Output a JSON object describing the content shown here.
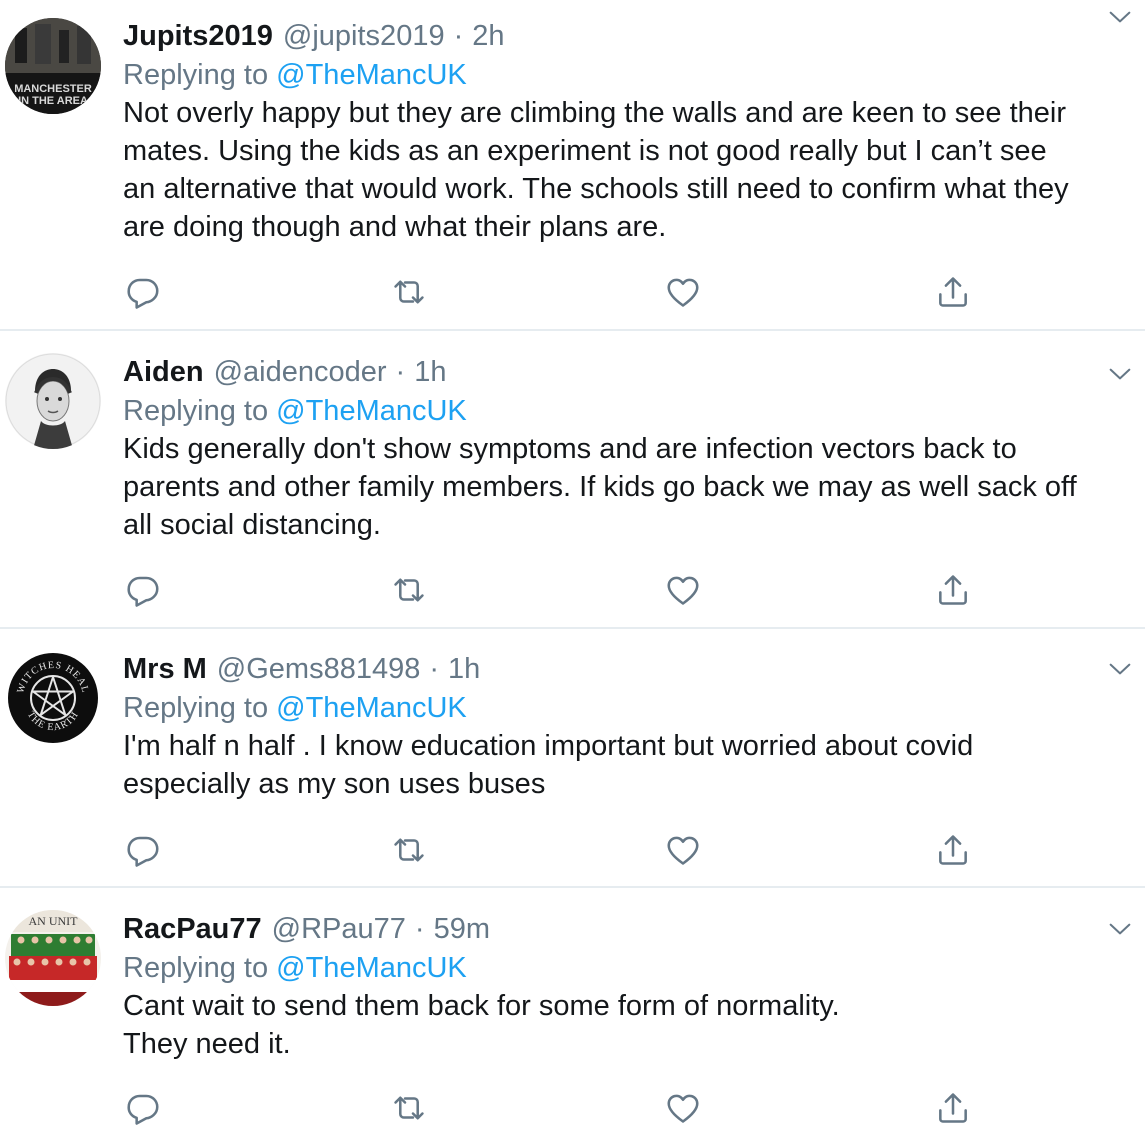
{
  "replying_prefix": "Replying to",
  "tweets": [
    {
      "name": "Jupits2019",
      "handle": "@jupits2019",
      "time": "2h",
      "reply_to": "@TheMancUK",
      "text": "Not overly happy but they are climbing the walls and are keen to see their\nmates. Using the kids as an experiment is not good really but I can’t see\nan alternative that would work. The schools still need to confirm what they\nare doing though and what their plans are.",
      "avatar": {
        "line1": "MANCHESTER",
        "line2": "IN THE AREA"
      }
    },
    {
      "name": "Aiden",
      "handle": "@aidencoder",
      "time": "1h",
      "reply_to": "@TheMancUK",
      "text": "Kids generally don't show symptoms and are infection vectors back to\nparents and other family members. If kids go back we may as well sack off\nall social distancing."
    },
    {
      "name": "Mrs M",
      "handle": "@Gems881498",
      "time": "1h",
      "reply_to": "@TheMancUK",
      "text": "I'm half n half . I know education important but worried about covid\nespecially as my son uses  buses",
      "avatar": {
        "top": "WITCHES HEAL",
        "bottom": "THE EARTH"
      }
    },
    {
      "name": "RacPau77",
      "handle": "@RPau77",
      "time": "59m",
      "reply_to": "@TheMancUK",
      "text": "Cant wait to send them back for some form of normality.\nThey need it.",
      "avatar": {
        "top": "AN UNIT"
      }
    }
  ],
  "icons": {
    "reply": "reply-icon",
    "retweet": "retweet-icon",
    "like": "like-icon",
    "share": "share-icon",
    "menu": "chevron-down-icon"
  },
  "colors": {
    "text": "#14171a",
    "secondary": "#657786",
    "link": "#1da1f2",
    "divider": "#e6ecf0"
  }
}
